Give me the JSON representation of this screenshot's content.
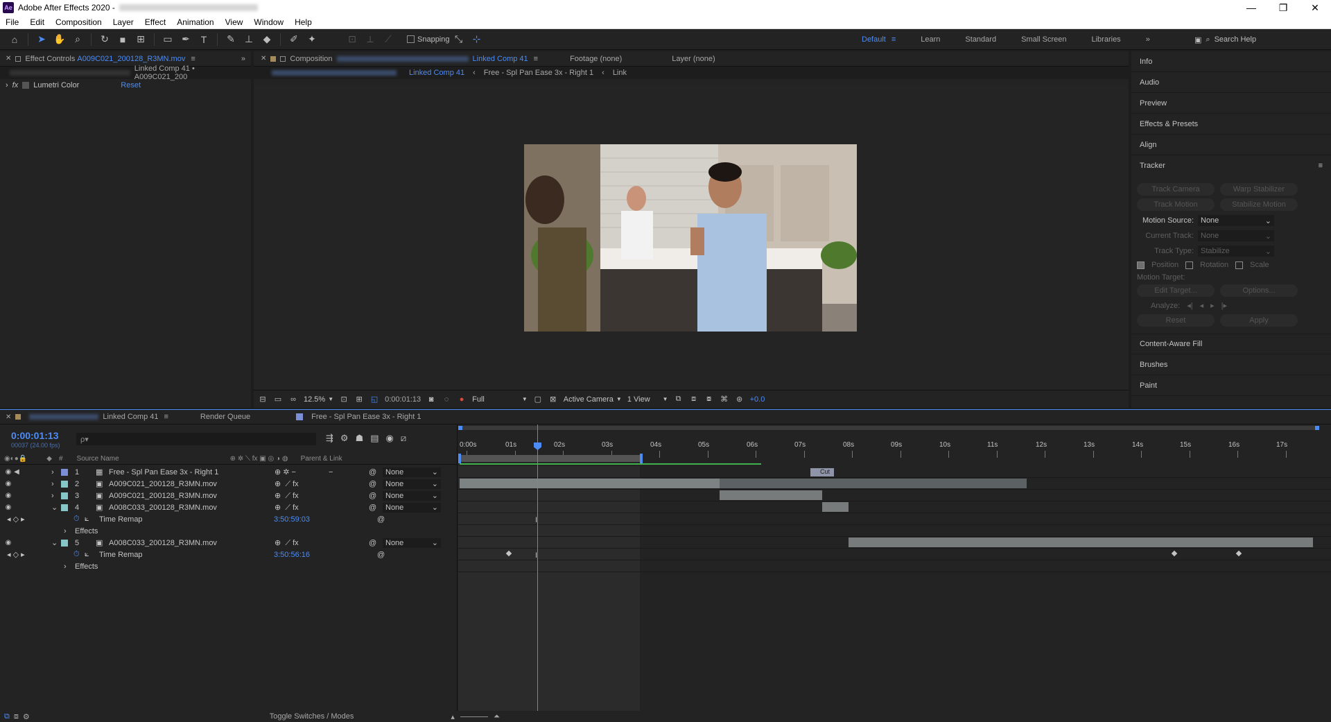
{
  "app": {
    "title": "Adobe After Effects 2020 -",
    "logo_text": "Ae",
    "window_buttons": [
      "—",
      "❐",
      "✕"
    ]
  },
  "menu": [
    "File",
    "Edit",
    "Composition",
    "Layer",
    "Effect",
    "Animation",
    "View",
    "Window",
    "Help"
  ],
  "toolbar": {
    "snapping_label": "Snapping",
    "workspaces": [
      "Default",
      "Learn",
      "Standard",
      "Small Screen",
      "Libraries"
    ],
    "active_workspace": "Default",
    "search_placeholder": "Search Help",
    "more_chevron": "»"
  },
  "effect_controls": {
    "tab_prefix": "Effect Controls",
    "tab_layer": "A009C021_200128_R3MN.mov",
    "breadcrumb": "Linked Comp 41 • A009C021_200",
    "effect_name": "Lumetri Color",
    "reset_label": "Reset"
  },
  "composition": {
    "tab_prefix": "Composition",
    "tab_name": "Linked Comp 41",
    "footage_tab": "Footage (none)",
    "layer_tab": "Layer (none)",
    "flow": [
      "Linked Comp 41",
      "Free - Spl Pan Ease 3x - Right 1",
      "Link"
    ],
    "zoom": "12.5%",
    "timecode": "0:00:01:13",
    "resolution": "Full",
    "camera": "Active Camera",
    "views": "1 View",
    "exposure": "+0.0"
  },
  "right_panel": {
    "items_top": [
      "Info",
      "Audio",
      "Preview",
      "Effects & Presets",
      "Align"
    ],
    "tracker_title": "Tracker",
    "tracker_buttons": [
      [
        "Track Camera",
        "Warp Stabilizer"
      ],
      [
        "Track Motion",
        "Stabilize Motion"
      ]
    ],
    "motion_source_label": "Motion Source:",
    "motion_source_value": "None",
    "current_track_label": "Current Track:",
    "current_track_value": "None",
    "track_type_label": "Track Type:",
    "track_type_value": "Stabilize",
    "checks": [
      "Position",
      "Rotation",
      "Scale"
    ],
    "motion_target_label": "Motion Target:",
    "edit_target": "Edit Target...",
    "options": "Options...",
    "analyze_label": "Analyze:",
    "reset": "Reset",
    "apply": "Apply",
    "items_bottom": [
      "Content-Aware Fill",
      "Brushes",
      "Paint"
    ]
  },
  "timeline": {
    "tab_name": "Linked Comp 41",
    "render_queue": "Render Queue",
    "other_tab": "Free - Spl Pan Ease 3x - Right 1",
    "timecode": "0:00:01:13",
    "timecode_sub": "00037 (24.00 fps)",
    "search_placeholder": "ρ▾",
    "col_source": "Source Name",
    "col_parent": "Parent & Link",
    "ruler_labels": [
      "0:00s",
      "01s",
      "02s",
      "03s",
      "04s",
      "05s",
      "06s",
      "07s",
      "08s",
      "09s",
      "10s",
      "11s",
      "12s",
      "13s",
      "14s",
      "15s",
      "16s",
      "17s"
    ],
    "layers": [
      {
        "num": "1",
        "name": "Free - Spl Pan Ease 3x - Right 1",
        "parent": "None",
        "color": "#7b8fd6"
      },
      {
        "num": "2",
        "name": "A009C021_200128_R3MN.mov",
        "parent": "None",
        "color": "#86c6c6"
      },
      {
        "num": "3",
        "name": "A009C021_200128_R3MN.mov",
        "parent": "None",
        "color": "#86c6c6"
      },
      {
        "num": "4",
        "name": "A008C033_200128_R3MN.mov",
        "parent": "None",
        "color": "#86c6c6"
      },
      {
        "num": "5",
        "name": "A008C033_200128_R3MN.mov",
        "parent": "None",
        "color": "#86c6c6"
      }
    ],
    "prop_time_remap": "Time Remap",
    "prop_effects": "Effects",
    "remap_value_4": "3:50:59:03",
    "remap_value_5": "3:50:56:16",
    "marker_label": "Cut",
    "footer_label": "Toggle Switches / Modes"
  },
  "colors": {
    "accent": "#4d8cf5",
    "panel": "#232323",
    "bg": "#1d1d1d"
  }
}
